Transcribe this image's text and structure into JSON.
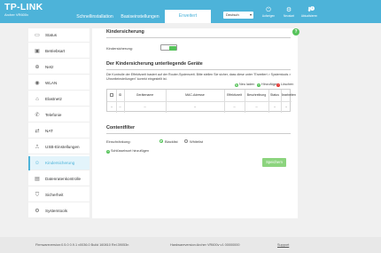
{
  "header": {
    "brand": "TP-LINK",
    "model": "Archer VR600v",
    "tabs": [
      {
        "label": "Schnellinstallation"
      },
      {
        "label": "Basiseinstellungen"
      },
      {
        "label": "Erweitert"
      }
    ],
    "language": "Deutsch",
    "icons": [
      {
        "label": "Aufzeigen",
        "icon": "logout-icon"
      },
      {
        "label": "Neustart",
        "icon": "reboot-icon"
      },
      {
        "label": "Aktualisieren",
        "icon": "update-icon",
        "badge": "1"
      }
    ],
    "accent_color": "#4db3d9"
  },
  "sidebar": {
    "items": [
      {
        "label": "Status",
        "icon": "status-icon"
      },
      {
        "label": "Betriebsart",
        "icon": "operation-mode-icon"
      },
      {
        "label": "Netz",
        "icon": "network-icon"
      },
      {
        "label": "WLAN",
        "icon": "wifi-icon"
      },
      {
        "label": "Elastnetz",
        "icon": "mesh-icon"
      },
      {
        "label": "Telefonie",
        "icon": "phone-icon"
      },
      {
        "label": "NAT",
        "icon": "nat-icon"
      },
      {
        "label": "USB-Einstellungen",
        "icon": "usb-icon"
      },
      {
        "label": "Kindersicherung",
        "icon": "parental-control-icon"
      },
      {
        "label": "Datenratenkontrolle",
        "icon": "bandwidth-icon"
      },
      {
        "label": "Sicherheit",
        "icon": "security-icon"
      },
      {
        "label": "Systemtools",
        "icon": "system-tools-icon"
      }
    ],
    "active_index": 8
  },
  "main": {
    "section1_title": "Kindersicherung",
    "toggle_label": "Kindersicherung:",
    "toggle_on": true,
    "section2_title": "Der Kindersicherung unterliegende Geräte",
    "description": "Die Kontrolle der Effektivzeit basiert auf der Router-Systemzeit. Bitte stellen Sie sicher, dass diese unter \"Erweitert > Systemtools > Uhrzeiteinstellungen\" korrekt eingestellt ist.",
    "actions": {
      "new": "Neu laden",
      "add": "Hinzufügen",
      "delete": "Löschen"
    },
    "table": {
      "headers": [
        "",
        "ID",
        "Gerätename",
        "MAC-Adresse",
        "Effektivzeit",
        "Beschreibung",
        "Status",
        "Bearbeiten"
      ],
      "row": [
        "",
        "--",
        "--",
        "--",
        "--",
        "--",
        "--",
        "--"
      ]
    },
    "section3_title": "Contentfilter",
    "restriction_label": "Einschränkung:",
    "blacklist": "Blacklist",
    "whitelist": "Whitelist",
    "add_keyword": "Schlüsselwort hinzufügen",
    "save": "Speichern",
    "help_glyph": "?"
  },
  "footer": {
    "firmware": "Firmwareversion:0.5.0 0.9.1 v0036.0 Build 160810 Rel.39053n",
    "hardware": "Hardwareversion:Archer VR600v v1 00000000",
    "support": "Support"
  }
}
